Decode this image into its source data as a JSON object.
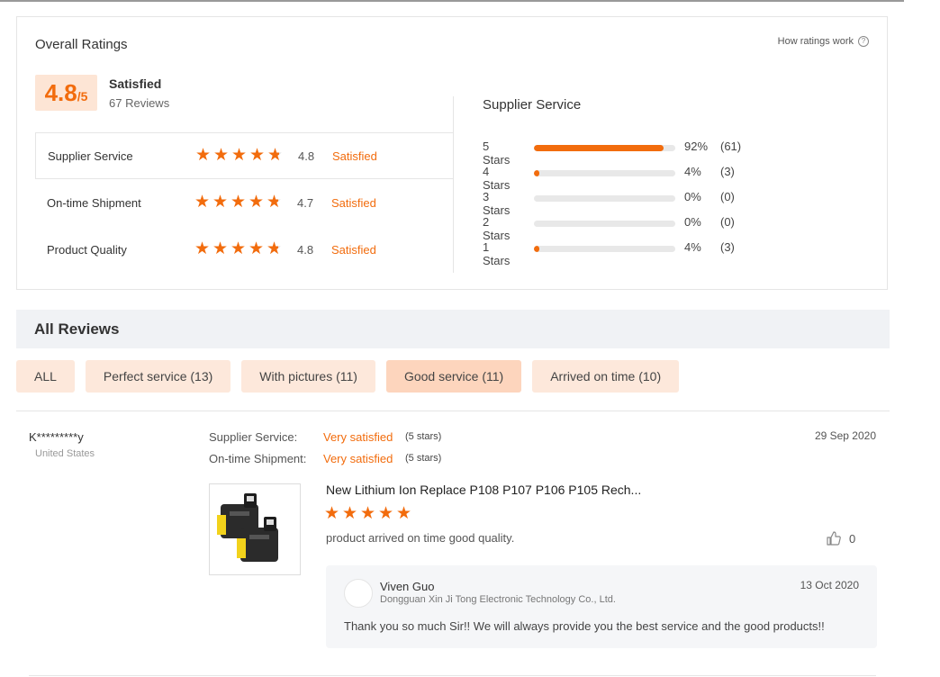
{
  "overall": {
    "title": "Overall Ratings",
    "how_link": "How ratings work",
    "score": "4.8",
    "score_max": "/5",
    "level": "Satisfied",
    "reviews_count": "67 Reviews"
  },
  "aspects": [
    {
      "name": "Supplier Service",
      "value": "4.8",
      "label": "Satisfied",
      "rating": 4.8
    },
    {
      "name": "On-time Shipment",
      "value": "4.7",
      "label": "Satisfied",
      "rating": 4.7
    },
    {
      "name": "Product Quality",
      "value": "4.8",
      "label": "Satisfied",
      "rating": 4.8
    }
  ],
  "distribution": {
    "title": "Supplier Service",
    "rows": [
      {
        "label": "5  Stars",
        "pct": "92%",
        "count": "(61)",
        "fill": 0.92
      },
      {
        "label": "4  Stars",
        "pct": "4%",
        "count": "(3)",
        "fill": 0.04
      },
      {
        "label": "3  Stars",
        "pct": "0%",
        "count": "(0)",
        "fill": 0
      },
      {
        "label": "2  Stars",
        "pct": "0%",
        "count": "(0)",
        "fill": 0
      },
      {
        "label": "1  Stars",
        "pct": "4%",
        "count": "(3)",
        "fill": 0.04
      }
    ]
  },
  "all_reviews": {
    "title": "All Reviews",
    "filters": [
      "ALL",
      "Perfect service (13)",
      "With pictures (11)",
      "Good service (11)",
      "Arrived on time (10)"
    ],
    "selected_filter": "Good service (11)"
  },
  "review": {
    "reviewer": "K*********y",
    "country": "United States",
    "date": "29 Sep 2020",
    "service_label": "Supplier Service:",
    "service_value": "Very satisfied",
    "service_stars": "(5 stars)",
    "shipment_label": "On-time Shipment:",
    "shipment_value": "Very satisfied",
    "shipment_stars": "(5 stars)",
    "product_title": "New Lithium Ion Replace P108 P107 P106 P105 Rech...",
    "stars": 5,
    "text": "product arrived on time good quality.",
    "likes": "0",
    "reply": {
      "name": "Viven Guo",
      "company": "Dongguan Xin Ji Tong Electronic Technology Co., Ltd.",
      "date": "13 Oct 2020",
      "text": "Thank you so much Sir!! We will always provide you the best service and the good products!!"
    }
  },
  "colors": {
    "accent": "#f26c0d",
    "accent_light": "#fde5d5"
  }
}
